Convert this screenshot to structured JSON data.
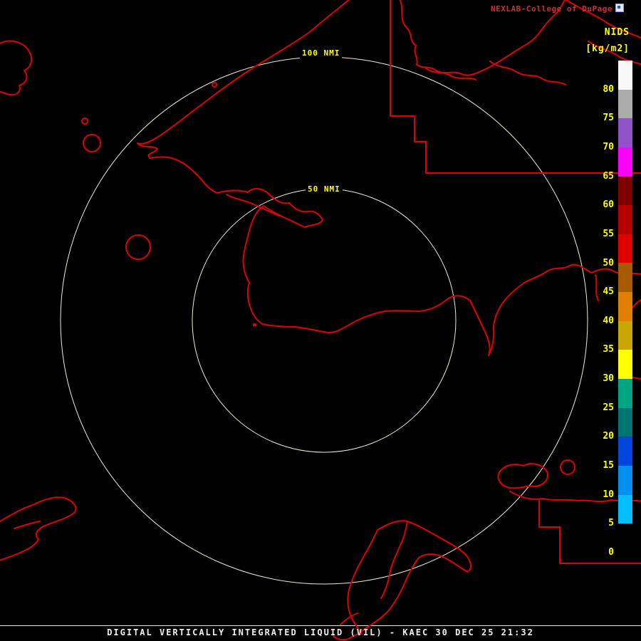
{
  "header": {
    "brand": "NEXLAB-College of DuPage",
    "product": "NIDS",
    "units": "[kg/m2]"
  },
  "colorbar": {
    "ticks": [
      80,
      75,
      70,
      65,
      60,
      55,
      50,
      45,
      40,
      35,
      30,
      25,
      20,
      15,
      10,
      5,
      0
    ],
    "segments": [
      {
        "from": 0,
        "to": 5,
        "color": "#000000"
      },
      {
        "from": 5,
        "to": 10,
        "color": "#00BFFF"
      },
      {
        "from": 10,
        "to": 15,
        "color": "#0090F0"
      },
      {
        "from": 15,
        "to": 20,
        "color": "#0046DC"
      },
      {
        "from": 20,
        "to": 25,
        "color": "#007472"
      },
      {
        "from": 25,
        "to": 30,
        "color": "#00A584"
      },
      {
        "from": 30,
        "to": 35,
        "color": "#FFFF00"
      },
      {
        "from": 35,
        "to": 40,
        "color": "#C8A800"
      },
      {
        "from": 40,
        "to": 45,
        "color": "#E08000"
      },
      {
        "from": 45,
        "to": 50,
        "color": "#A85A00"
      },
      {
        "from": 50,
        "to": 55,
        "color": "#E00000"
      },
      {
        "from": 55,
        "to": 60,
        "color": "#B40000"
      },
      {
        "from": 60,
        "to": 65,
        "color": "#7E0000"
      },
      {
        "from": 65,
        "to": 70,
        "color": "#FF00FF"
      },
      {
        "from": 70,
        "to": 75,
        "color": "#9153C8"
      },
      {
        "from": 75,
        "to": 80,
        "color": "#ABABAB"
      },
      {
        "from": 80,
        "to": 85,
        "color": "#F8F8F8"
      }
    ]
  },
  "map": {
    "range_rings": [
      {
        "label": "100 NMI"
      },
      {
        "label": "50 NMI"
      }
    ],
    "coast_color": "#E00000",
    "ring_color": "#F2ECDA",
    "label_color": "#FFFF00"
  },
  "footer": {
    "title": "DIGITAL VERTICALLY INTEGRATED LIQUID (VIL) - KAEC 30 DEC 25 21:32"
  }
}
